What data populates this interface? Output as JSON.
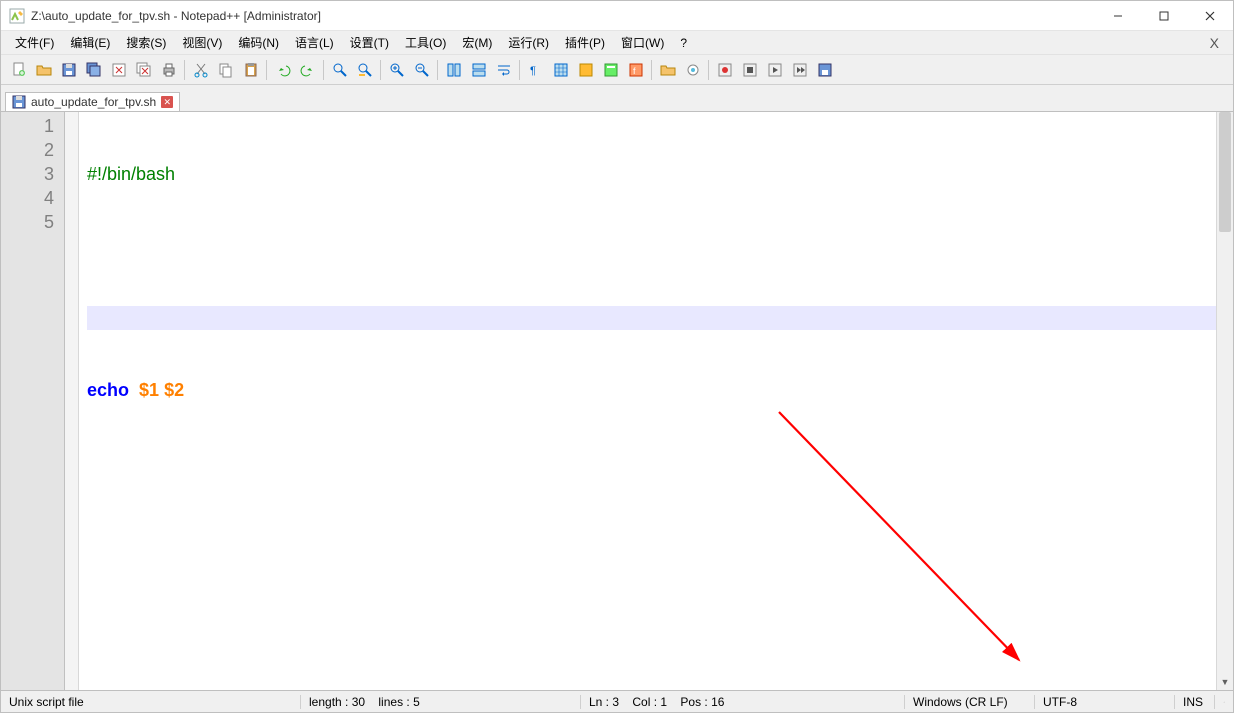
{
  "title": "Z:\\auto_update_for_tpv.sh - Notepad++ [Administrator]",
  "menu": {
    "file": "文件(F)",
    "edit": "编辑(E)",
    "search": "搜索(S)",
    "view": "视图(V)",
    "encode": "编码(N)",
    "lang": "语言(L)",
    "setting": "设置(T)",
    "tool": "工具(O)",
    "macro": "宏(M)",
    "run": "运行(R)",
    "plugin": "插件(P)",
    "window": "窗口(W)",
    "help": "?"
  },
  "tab": {
    "label": "auto_update_for_tpv.sh"
  },
  "code": {
    "lines": [
      "1",
      "2",
      "3",
      "4",
      "5"
    ],
    "l1_shebang": "#!/bin/bash",
    "l4_cmd": "echo",
    "l4_sp": "  ",
    "l4_a1": "$1",
    "l4_a2": "$2"
  },
  "status": {
    "filetype": "Unix script file",
    "length": "length : 30",
    "lines": "lines : 5",
    "ln": "Ln : 3",
    "col": "Col : 1",
    "pos": "Pos : 16",
    "eol": "Windows (CR LF)",
    "enc": "UTF-8",
    "mode": "INS"
  }
}
